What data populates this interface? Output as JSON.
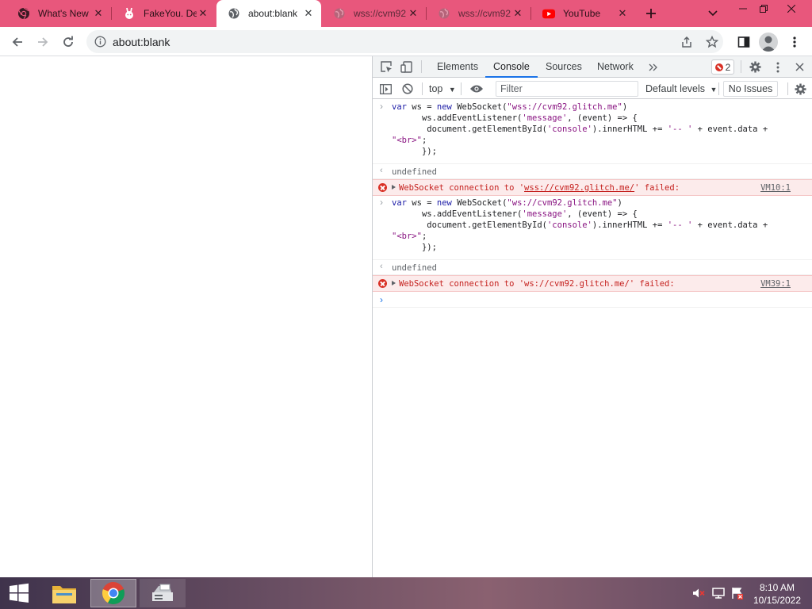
{
  "browser": {
    "tabs": [
      {
        "title": "What's New",
        "icon": "chrome-icon",
        "active": false
      },
      {
        "title": "FakeYou. De",
        "icon": "fakeyou-icon",
        "active": false
      },
      {
        "title": "about:blank",
        "icon": "globe-icon",
        "active": true
      },
      {
        "title": "wss://cvm92",
        "icon": "globe-icon",
        "active": false
      },
      {
        "title": "wss://cvm92",
        "icon": "globe-icon",
        "active": false
      },
      {
        "title": "YouTube",
        "icon": "youtube-icon",
        "active": false
      }
    ],
    "address": "about:blank"
  },
  "devtools": {
    "tabs": [
      "Elements",
      "Console",
      "Sources",
      "Network"
    ],
    "active_tab": "Console",
    "error_count": "2",
    "context": "top",
    "filter_placeholder": "Filter",
    "levels": "Default levels",
    "issues": "No Issues",
    "console": {
      "cmd1": {
        "l1a": "var",
        "l1b": " ws = ",
        "l1c": "new",
        "l1d": " WebSocket(",
        "l1e": "\"wss://cvm92.glitch.me\"",
        "l1f": ")",
        "l2a": "      ws.addEventListener(",
        "l2b": "'message'",
        "l2c": ", (event) => {",
        "l3a": "       document.getElementById(",
        "l3b": "'console'",
        "l3c": ").innerHTML += ",
        "l3d": "'-- '",
        "l3e": " + event.data +",
        "l4a": "\"<br>\"",
        "l4b": ";",
        "l5": "      });"
      },
      "result1": "undefined",
      "error1": {
        "pre": "WebSocket connection to '",
        "url": "wss://cvm92.glitch.me/",
        "post": "' failed:",
        "source": "VM10:1"
      },
      "cmd2": {
        "l1a": "var",
        "l1b": " ws = ",
        "l1c": "new",
        "l1d": " WebSocket(",
        "l1e": "\"ws://cvm92.glitch.me\"",
        "l1f": ")",
        "l2a": "      ws.addEventListener(",
        "l2b": "'message'",
        "l2c": ", (event) => {",
        "l3a": "       document.getElementById(",
        "l3b": "'console'",
        "l3c": ").innerHTML += ",
        "l3d": "'-- '",
        "l3e": " + event.data +",
        "l4a": "\"<br>\"",
        "l4b": ";",
        "l5": "      });"
      },
      "result2": "undefined",
      "error2": {
        "text": "WebSocket connection to 'ws://cvm92.glitch.me/' failed:",
        "source": "VM39:1"
      }
    }
  },
  "taskbar": {
    "time": "8:10 AM",
    "date": "10/15/2022"
  },
  "colors": {
    "tabstrip": "#e8577c",
    "error_red": "#d93025",
    "devtools_blue": "#1a73e8"
  }
}
